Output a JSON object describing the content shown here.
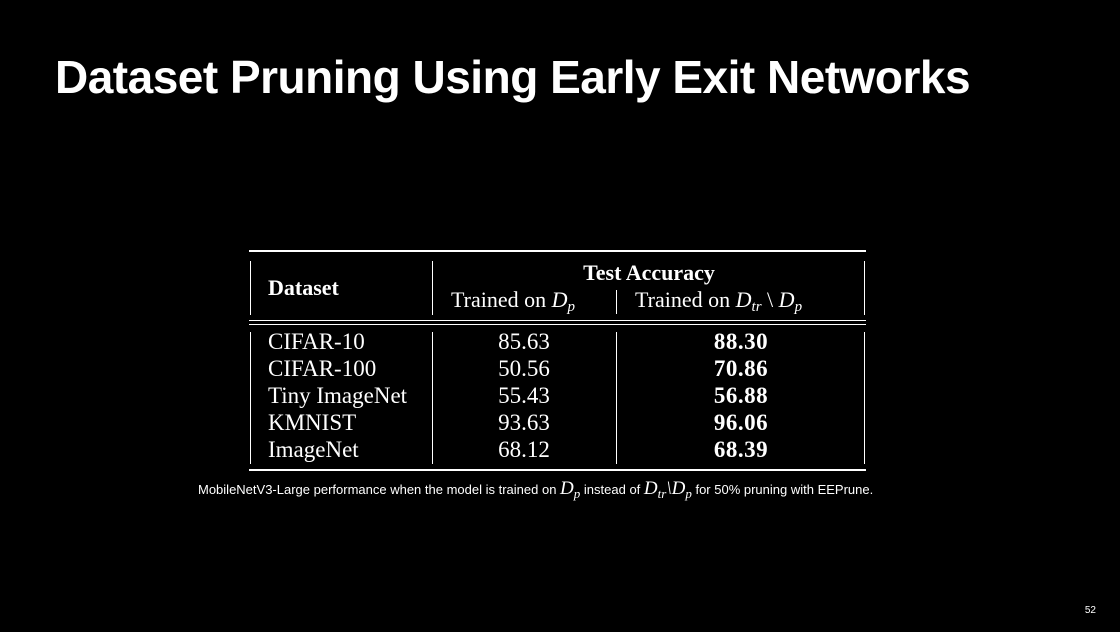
{
  "slide": {
    "title": "Dataset Pruning Using Early Exit Networks",
    "page_number": "52"
  },
  "table": {
    "header_dataset": "Dataset",
    "header_group": "Test Accuracy",
    "sub_trained_on_1": "Trained on",
    "sub_dp_1": "D",
    "sub_dp_1_subscript": "p",
    "sub_trained_on_2": "Trained on",
    "sub_dtr": "D",
    "sub_dtr_subscript": "tr",
    "sub_setminus": "\\",
    "sub_dp_2": "D",
    "sub_dp_2_subscript": "p",
    "rows": [
      {
        "dataset": "CIFAR-10",
        "dp": "85.63",
        "dtr_minus_dp": "88.30"
      },
      {
        "dataset": "CIFAR-100",
        "dp": "50.56",
        "dtr_minus_dp": "70.86"
      },
      {
        "dataset": "Tiny ImageNet",
        "dp": "55.43",
        "dtr_minus_dp": "56.88"
      },
      {
        "dataset": "KMNIST",
        "dp": "93.63",
        "dtr_minus_dp": "96.06"
      },
      {
        "dataset": "ImageNet",
        "dp": "68.12",
        "dtr_minus_dp": "68.39"
      }
    ]
  },
  "caption": {
    "part1": "MobileNetV3-Large performance when the model is trained on",
    "math1": "D",
    "math1_sub": "p",
    "part2": "instead of",
    "math2a": "D",
    "math2a_sub": "tr",
    "math2_sep": "\\",
    "math2b": "D",
    "math2b_sub": "p",
    "part3": "for 50% pruning with EEPrune."
  }
}
